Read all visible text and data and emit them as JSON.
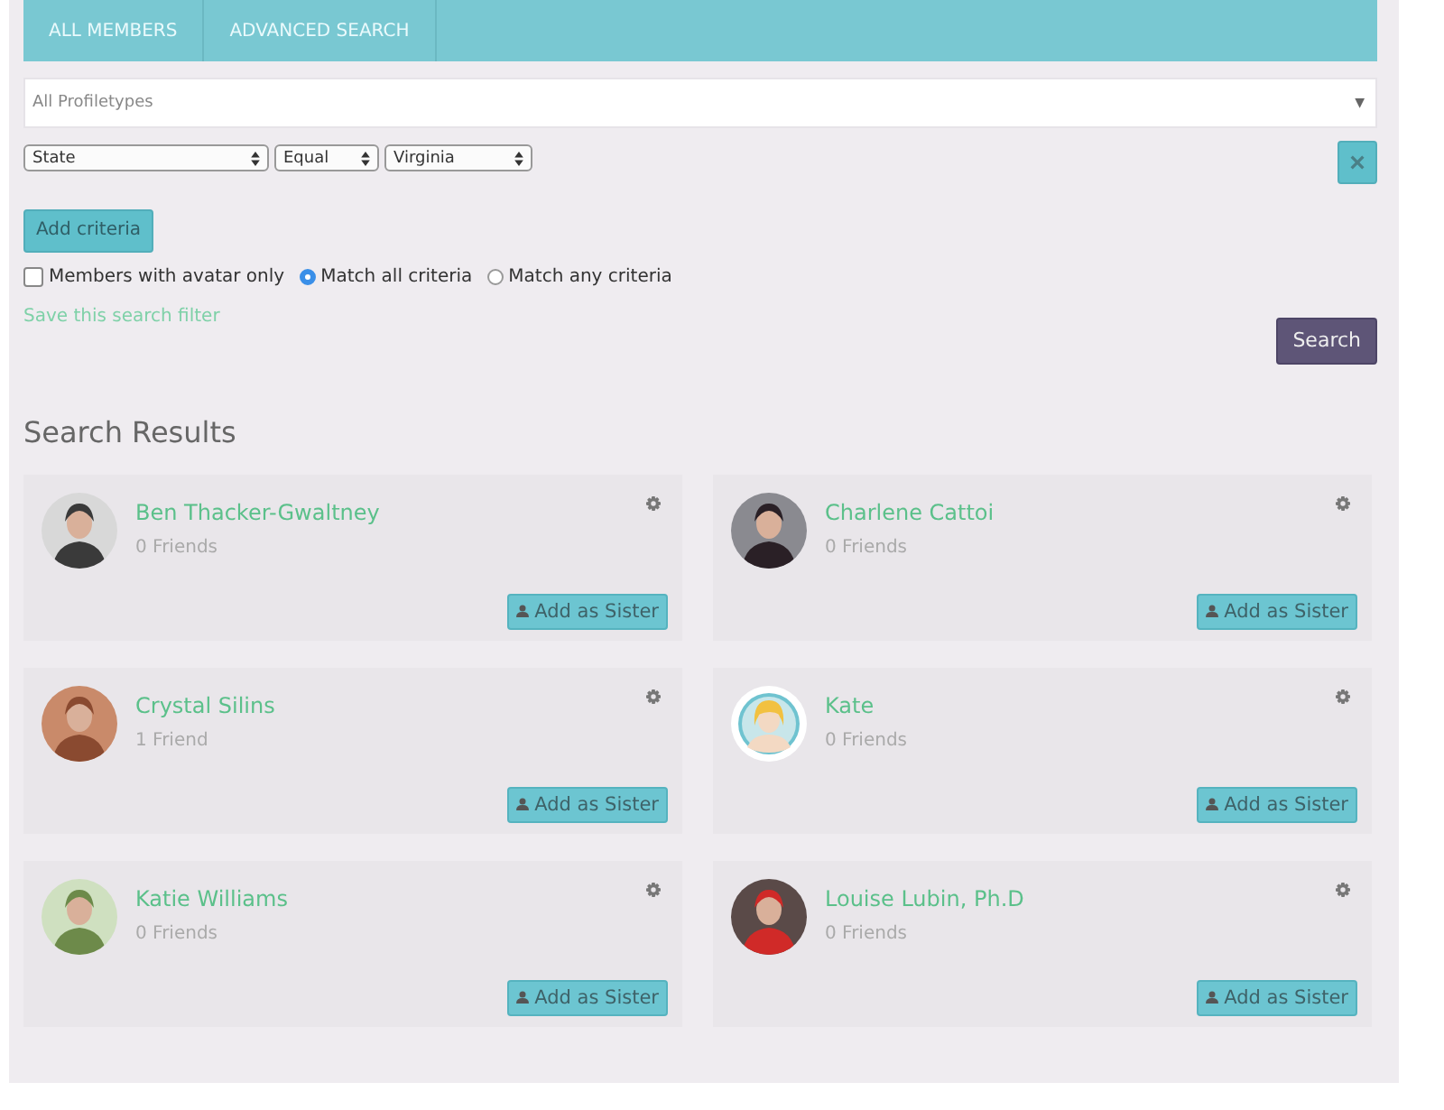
{
  "tabs": [
    {
      "label": "ALL MEMBERS",
      "selected": false
    },
    {
      "label": "ADVANCED SEARCH",
      "selected": false
    }
  ],
  "profiletype": {
    "value": "All Profiletypes",
    "arrow": "▼"
  },
  "criteria": [
    {
      "field": "State",
      "operator": "Equal",
      "value": "Virginia"
    }
  ],
  "remove_button": "×",
  "add_criteria": "Add criteria",
  "options": [
    {
      "kind": "checkbox",
      "label": "Members with avatar only",
      "selected": false
    },
    {
      "kind": "radio",
      "label": "Match all criteria",
      "selected": true
    },
    {
      "kind": "radio",
      "label": "Match any criteria",
      "selected": false
    }
  ],
  "save_filter": "Save this search filter",
  "search_button": "Search",
  "results_title": "Search Results",
  "members": [
    {
      "kind": "picture",
      "name": "Ben Thacker-Gwaltney",
      "friends": "0 Friends",
      "action": "Add as Sister"
    },
    {
      "kind": "picture",
      "name": "Charlene Cattoi",
      "friends": "0 Friends",
      "action": "Add as Sister"
    },
    {
      "kind": "picture",
      "name": "Crystal Silins",
      "friends": "1 Friend",
      "action": "Add as Sister"
    },
    {
      "kind": "default",
      "name": "Kate",
      "friends": "0 Friends",
      "action": "Add as Sister"
    },
    {
      "kind": "picture",
      "name": "Katie Williams",
      "friends": "0 Friends",
      "action": "Add as Sister"
    },
    {
      "kind": "picture",
      "name": "Louise Lubin, Ph.D",
      "friends": "0 Friends",
      "action": "Add as Sister"
    }
  ]
}
